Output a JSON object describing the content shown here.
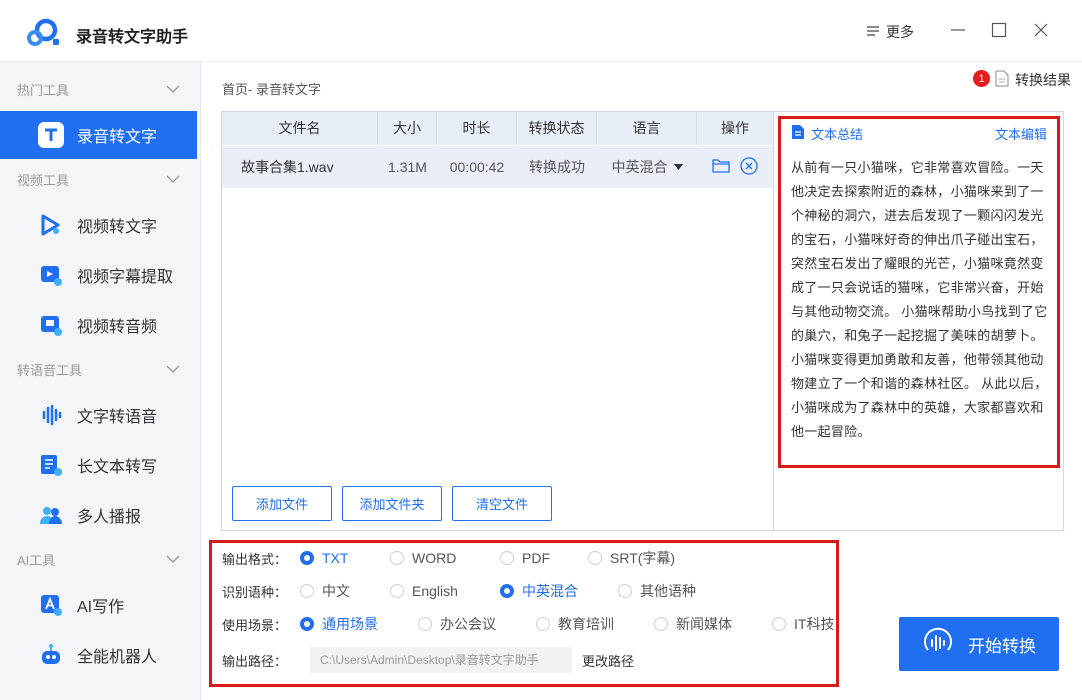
{
  "app": {
    "title": "录音转文字助手"
  },
  "titlebar": {
    "more_label": "更多"
  },
  "sidebar": {
    "sections": [
      {
        "title": "热门工具"
      },
      {
        "title": "视频工具"
      },
      {
        "title": "转语音工具"
      },
      {
        "title": "AI工具"
      }
    ],
    "items": [
      {
        "label": "录音转文字",
        "icon": "text-t-icon",
        "active": true
      },
      {
        "label": "视频转文字",
        "icon": "video-play-icon"
      },
      {
        "label": "视频字幕提取",
        "icon": "subtitle-icon"
      },
      {
        "label": "视频转音频",
        "icon": "video-audio-icon"
      },
      {
        "label": "文字转语音",
        "icon": "soundwave-icon"
      },
      {
        "label": "长文本转写",
        "icon": "document-a-icon"
      },
      {
        "label": "多人播报",
        "icon": "people-icon"
      },
      {
        "label": "AI写作",
        "icon": "ai-write-icon"
      },
      {
        "label": "全能机器人",
        "icon": "robot-icon"
      }
    ]
  },
  "main": {
    "breadcrumb": "首页- 录音转文字",
    "result_label": "转换结果",
    "result_badge": "1",
    "table": {
      "headers": [
        "文件名",
        "大小",
        "时长",
        "转换状态",
        "语言",
        "操作"
      ],
      "rows": [
        {
          "name": "故事合集1.wav",
          "size": "1.31M",
          "duration": "00:00:42",
          "status": "转换成功",
          "language": "中英混合"
        }
      ]
    },
    "buttons": {
      "add_file": "添加文件",
      "add_folder": "添加文件夹",
      "clear": "清空文件"
    },
    "summary": {
      "title": "文本总结",
      "edit": "文本编辑",
      "text": "从前有一只小猫咪，它非常喜欢冒险。一天他决定去探索附近的森林，小猫咪来到了一个神秘的洞穴，进去后发现了一颗闪闪发光的宝石，小猫咪好奇的伸出爪子碰出宝石，突然宝石发出了耀眼的光芒，小猫咪竟然变成了一只会说话的猫咪，它非常兴奋，开始与其他动物交流。 小猫咪帮助小鸟找到了它的巢穴，和兔子一起挖掘了美味的胡萝卜。 小猫咪变得更加勇敢和友善，他带领其他动物建立了一个和谐的森林社区。 从此以后，小猫咪成为了森林中的英雄，大家都喜欢和他一起冒险。"
    },
    "options": {
      "format": {
        "label": "输出格式：",
        "choices": [
          "TXT",
          "WORD",
          "PDF",
          "SRT(字幕)"
        ],
        "selected": "TXT"
      },
      "language": {
        "label": "识别语种：",
        "choices": [
          "中文",
          "English",
          "中英混合",
          "其他语种"
        ],
        "selected": "中英混合"
      },
      "scene": {
        "label": "使用场景：",
        "choices": [
          "通用场景",
          "办公会议",
          "教育培训",
          "新闻媒体",
          "IT科技"
        ],
        "selected": "通用场景"
      },
      "path": {
        "label": "输出路径：",
        "value": "C:\\Users\\Admin\\Desktop\\录音转文字助手",
        "change": "更改路径"
      }
    },
    "start_label": "开始转换"
  },
  "colors": {
    "accent": "#1f6ff0",
    "highlight_border": "#d91a1a",
    "sidebar_bg": "#f3f5f9"
  }
}
